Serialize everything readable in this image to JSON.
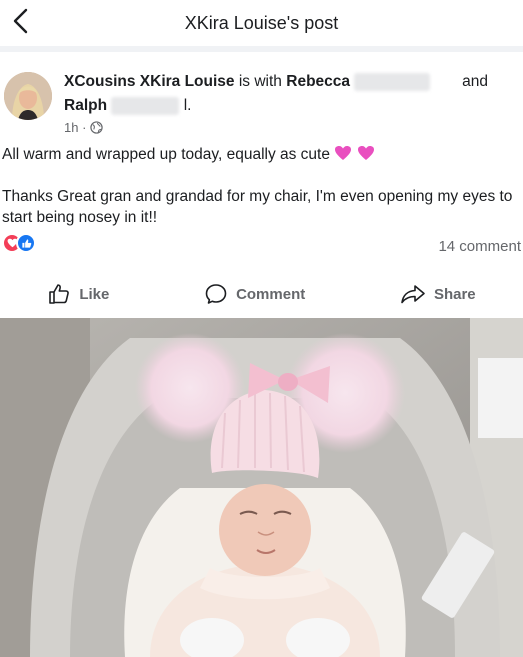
{
  "header": {
    "title": "XKira Louise's post",
    "back_icon": "chevron-left-icon"
  },
  "post": {
    "author": "XCousins XKira Louise",
    "with_text": "is with",
    "tagged_1": "Rebecca",
    "and_text": "and",
    "tagged_2": "Ralph",
    "tagged_2_suffix": "l.",
    "time": "1h ·",
    "privacy_icon": "globe-icon",
    "text_line1": "All warm and wrapped up today, equally as cute",
    "text_line2": "Thanks Great gran and grandad for my chair, I'm even opening my eyes to start being nosey in it!!",
    "comments": "14 comment"
  },
  "actions": {
    "like": "Like",
    "comment": "Comment",
    "share": "Share"
  },
  "colors": {
    "heart_emoji": "#e94fbf",
    "love_reaction": "#f33e58",
    "like_reaction": "#1877f2",
    "muted": "#65676b"
  }
}
